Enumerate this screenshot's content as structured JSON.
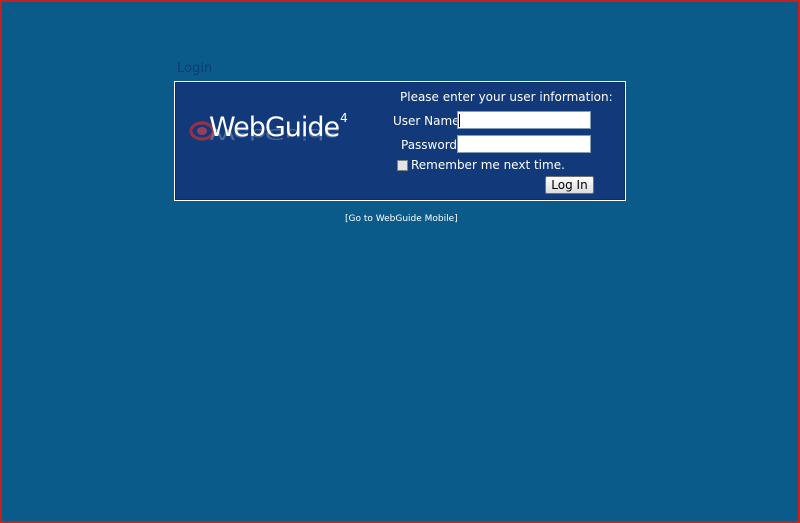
{
  "page": {
    "login_title": "Login",
    "mobile_link": "[Go to WebGuide Mobile]"
  },
  "logo": {
    "brand": "WebGuide",
    "version": "4"
  },
  "form": {
    "instructions": "Please enter your user information:",
    "username_label": "User Name:",
    "username_value": "",
    "password_label": "Password:",
    "password_value": "",
    "remember_label": "Remember me next time.",
    "remember_checked": false,
    "login_button": "Log In"
  },
  "colors": {
    "background": "#0a5a8a",
    "panel": "#123a7a",
    "title": "#0b3a7a",
    "window_border": "#c8201a"
  }
}
